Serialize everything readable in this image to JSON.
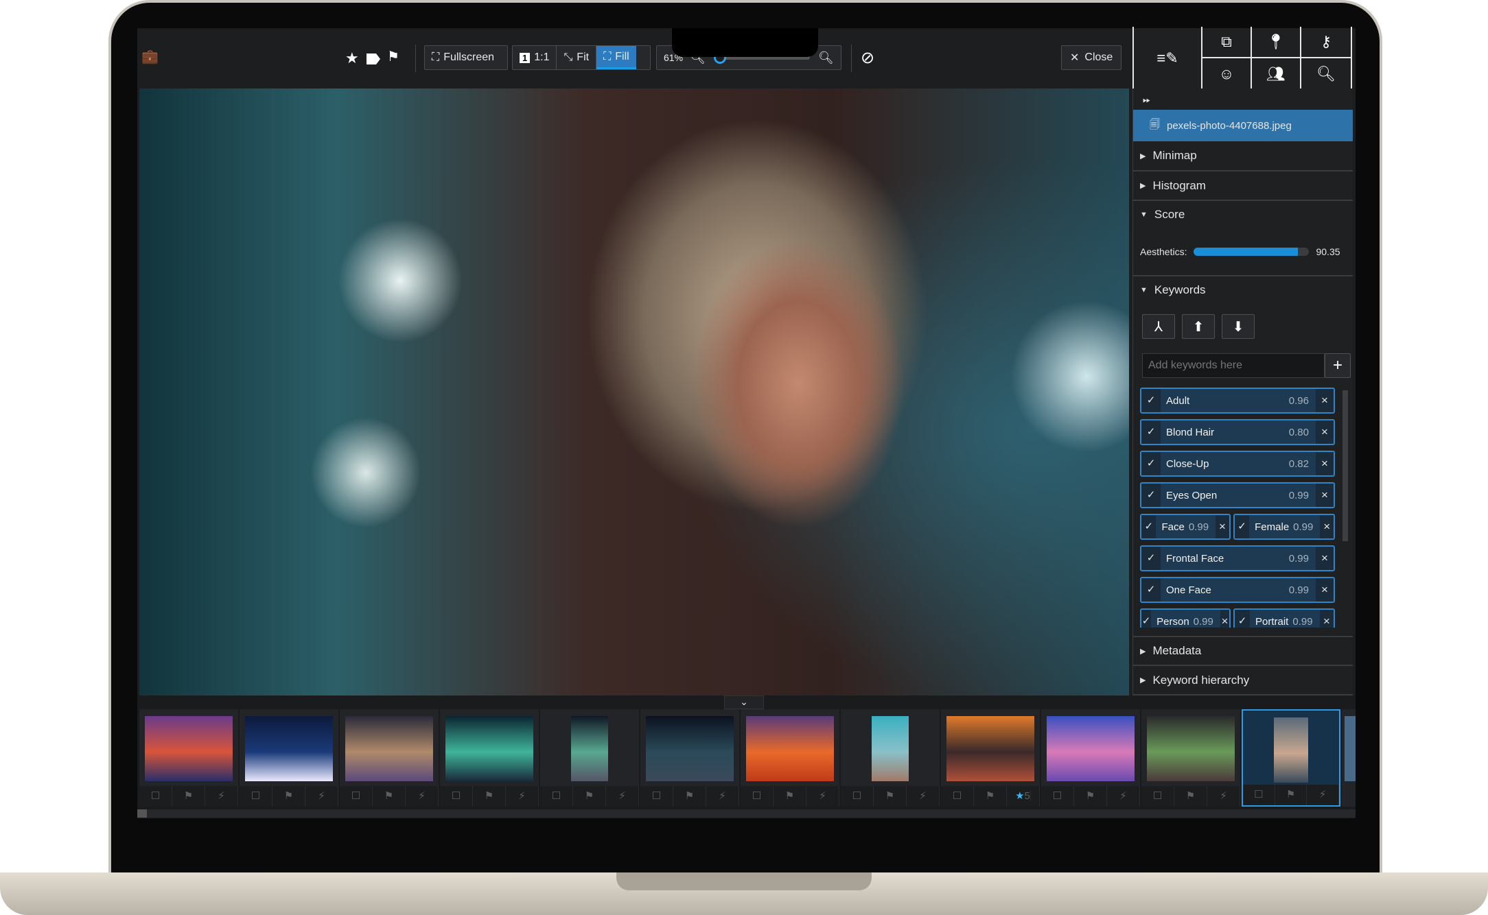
{
  "toolbar": {
    "fullscreen": "Fullscreen",
    "one_to_one": "1:1",
    "fit": "Fit",
    "fill": "Fill",
    "active_mode": "Fill",
    "zoom_percent": "61%",
    "zoom_level": 0.05,
    "close": "Close",
    "icons": [
      "briefcase-icon",
      "star-icon",
      "tag-icon",
      "flag-icon",
      "zoom-out-icon",
      "zoom-in-icon",
      "rotate-icon"
    ]
  },
  "panel_tabs": [
    "edit-metadata-icon",
    "copy-icon",
    "location-pin-icon",
    "key-icon",
    "face-icon",
    "people-icon",
    "search-icon"
  ],
  "panel": {
    "file_name": "pexels-photo-4407688.jpeg",
    "sections": {
      "minimap": "Minimap",
      "histogram": "Histogram",
      "score": "Score",
      "keywords": "Keywords",
      "metadata": "Metadata",
      "keyword_hierarchy": "Keyword hierarchy"
    },
    "score": {
      "label": "Aesthetics:",
      "value": "90.35",
      "fraction": 0.9035
    },
    "keyword_placeholder": "Add keywords here",
    "keywords": [
      {
        "label": "Adult",
        "score": "0.96"
      },
      {
        "label": "Blond Hair",
        "score": "0.80"
      },
      {
        "label": "Close-Up",
        "score": "0.82"
      },
      {
        "label": "Eyes Open",
        "score": "0.99"
      },
      {
        "label": "Face",
        "score": "0.99"
      },
      {
        "label": "Female",
        "score": "0.99"
      },
      {
        "label": "Frontal Face",
        "score": "0.99"
      },
      {
        "label": "One Face",
        "score": "0.99"
      },
      {
        "label": "Person",
        "score": "0.99"
      },
      {
        "label": "Portrait",
        "score": "0.99"
      }
    ]
  },
  "filmstrip": {
    "thumbnails": [
      {
        "colors": [
          "#6a3a8a",
          "#d8553a",
          "#2a2f6a"
        ]
      },
      {
        "colors": [
          "#0d1a3a",
          "#1a3a7a",
          "#e8e8ff"
        ]
      },
      {
        "colors": [
          "#2a2a3a",
          "#b08a6a",
          "#5a4a7a"
        ]
      },
      {
        "colors": [
          "#0b2430",
          "#3fb59a",
          "#1a2a3a"
        ]
      },
      {
        "colors": [
          "#101826",
          "#58a890",
          "#556"
        ]
      },
      {
        "colors": [
          "#0c121e",
          "#2a4a5a",
          "#3a4a5a"
        ]
      },
      {
        "colors": [
          "#5a3a7a",
          "#e86a2a",
          "#c03a1a"
        ]
      },
      {
        "colors": [
          "#3ab0c0",
          "#8ac0c8",
          "#a07a6a"
        ]
      },
      {
        "colors": [
          "#e07a2a",
          "#3a2a2a",
          "#b0503a"
        ]
      },
      {
        "colors": [
          "#3a50c0",
          "#d87ab8",
          "#6a4ab0"
        ]
      },
      {
        "colors": [
          "#2a2a2a",
          "#6a9a5a",
          "#4a3a3a"
        ]
      },
      {
        "colors": [
          "#5a6a7a",
          "#c8a890",
          "#3a4a5a"
        ]
      }
    ],
    "rated_index": 8,
    "rating": "5",
    "selected_index": 11
  }
}
